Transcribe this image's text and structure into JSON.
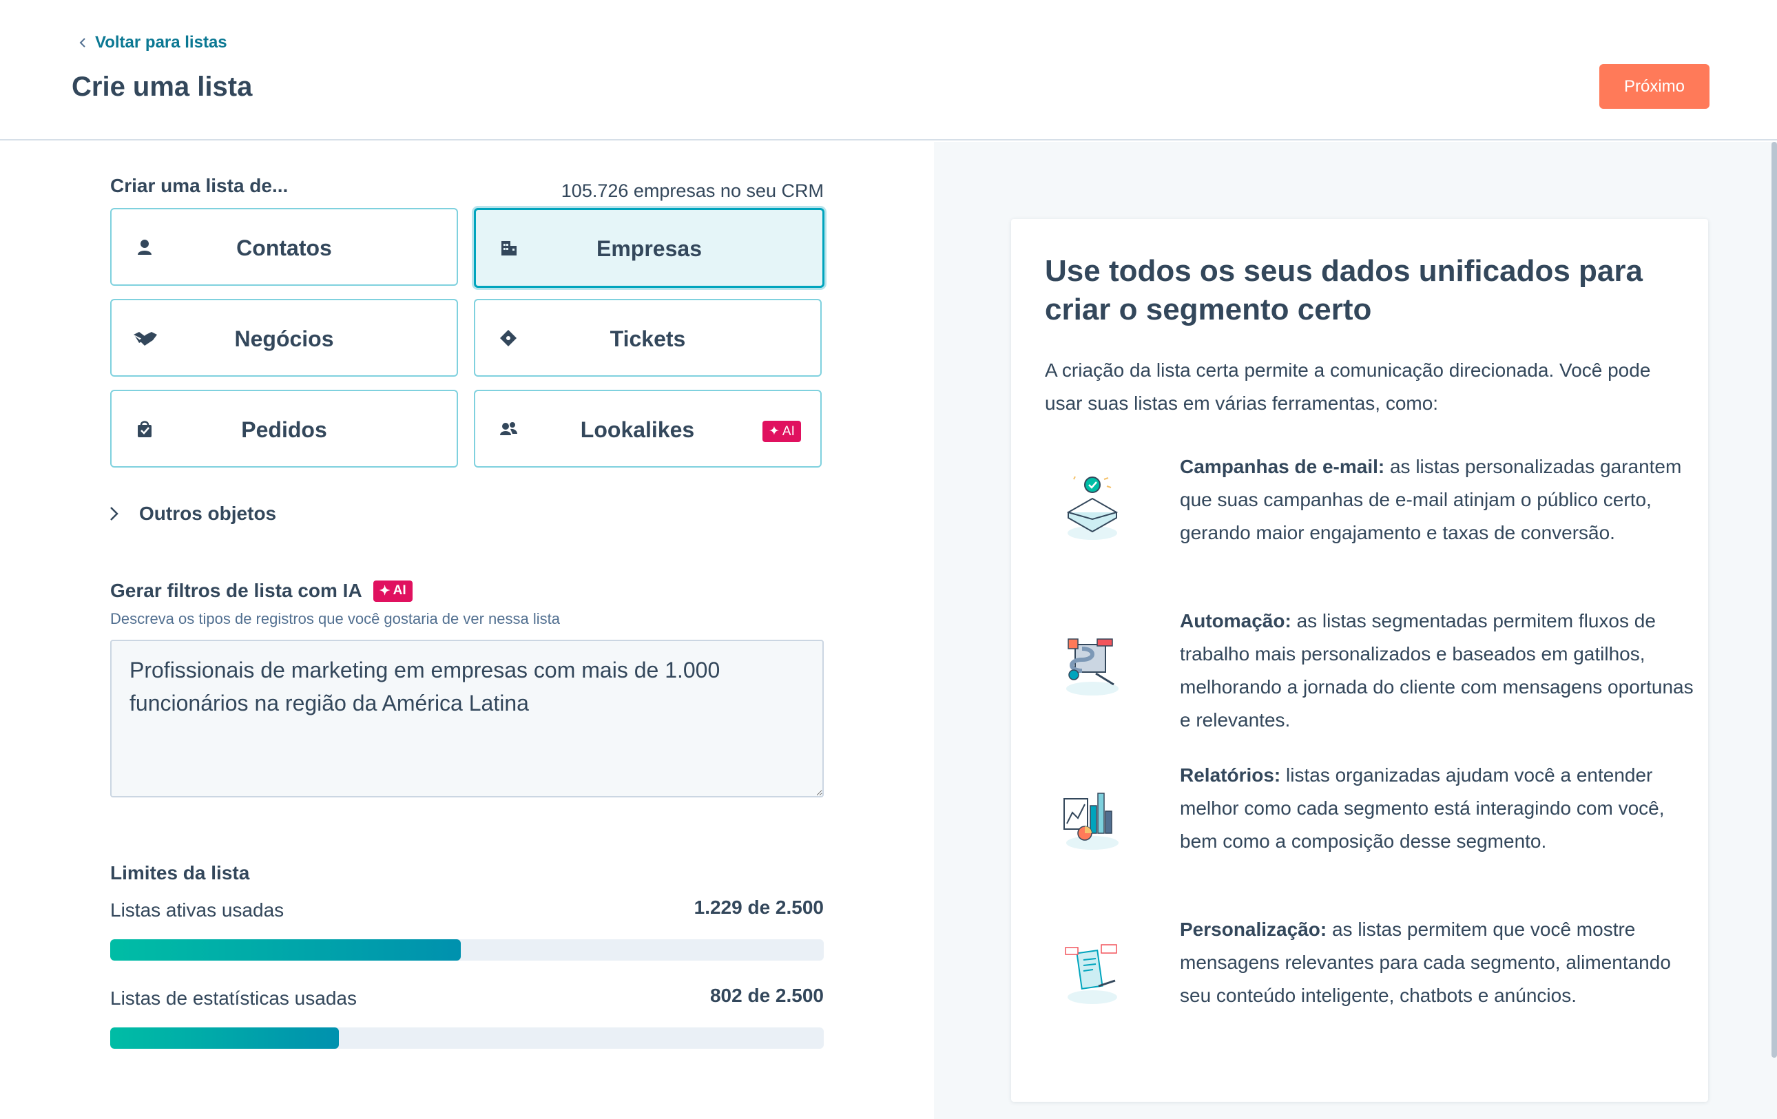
{
  "header": {
    "back_link": "Voltar para listas",
    "title": "Crie uma lista",
    "next_button": "Próximo"
  },
  "create": {
    "label": "Criar uma lista de...",
    "crm_count": "105.726 empresas no seu CRM",
    "objects": [
      {
        "label": "Contatos",
        "icon": "contact-icon",
        "selected": false
      },
      {
        "label": "Empresas",
        "icon": "company-building-icon",
        "selected": true
      },
      {
        "label": "Negócios",
        "icon": "handshake-icon",
        "selected": false
      },
      {
        "label": "Tickets",
        "icon": "ticket-icon",
        "selected": false
      },
      {
        "label": "Pedidos",
        "icon": "shopping-bag-icon",
        "selected": false
      },
      {
        "label": "Lookalikes",
        "icon": "users-icon",
        "selected": false,
        "badge": "AI"
      }
    ],
    "other_objects": "Outros objetos"
  },
  "ai_filters": {
    "title": "Gerar filtros de lista com IA",
    "badge": "AI",
    "subtitle": "Descreva os tipos de registros que você gostaria de ver nessa lista",
    "value": "Profissionais de marketing em empresas com mais de 1.000 funcionários na região da América Latina"
  },
  "limits": {
    "title": "Limites da lista",
    "active": {
      "label": "Listas ativas usadas",
      "value": "1.229 de 2.500",
      "used": 1229,
      "total": 2500
    },
    "static": {
      "label": "Listas de estatísticas usadas",
      "value": "802 de 2.500",
      "used": 802,
      "total": 2500
    }
  },
  "info": {
    "title": "Use todos os seus dados unificados para criar o segmento certo",
    "intro": "A criação da lista certa permite a comunicação direcionada. Você pode usar suas listas em várias ferramentas, como:",
    "features": [
      {
        "title": "Campanhas de e-mail:",
        "text": " as listas personalizadas garantem que suas campanhas de e-mail atinjam o público certo, gerando maior engajamento e taxas de conversão.",
        "icon": "email-campaign-illustration"
      },
      {
        "title": "Automação:",
        "text": " as listas segmentadas permitem fluxos de trabalho mais personalizados e baseados em gatilhos, melhorando a jornada do cliente com mensagens oportunas e relevantes.",
        "icon": "automation-illustration"
      },
      {
        "title": "Relatórios:",
        "text": " listas organizadas ajudam você a entender melhor como cada segmento está interagindo com você, bem como a composição desse segmento.",
        "icon": "reports-illustration"
      },
      {
        "title": "Personalização:",
        "text": " as listas permitem que você mostre mensagens relevantes para cada segmento, alimentando seu conteúdo inteligente, chatbots e anúncios.",
        "icon": "personalization-illustration"
      }
    ]
  },
  "colors": {
    "accent": "#ff7a59",
    "teal": "#00a4bd",
    "ai_badge": "#e0115f",
    "text": "#33475b"
  }
}
